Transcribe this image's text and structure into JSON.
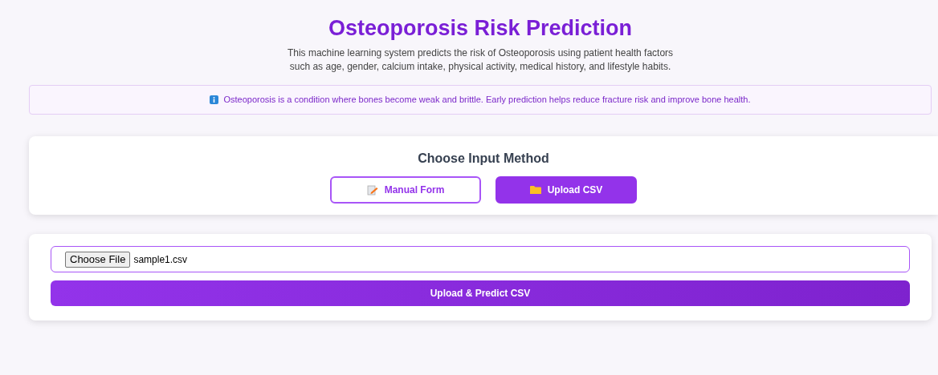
{
  "header": {
    "title": "Osteoporosis Risk Prediction",
    "description_lines": [
      "This machine learning system predicts the risk of Osteoporosis using patient health factors",
      "such as age, gender, calcium intake, physical activity, medical history, and lifestyle habits."
    ]
  },
  "info_banner": {
    "text": "Osteoporosis is a condition where bones become weak and brittle. Early prediction helps reduce fracture risk and improve bone health."
  },
  "input_method": {
    "heading": "Choose Input Method",
    "options": [
      {
        "label": "Manual Form",
        "kind": "form",
        "selected": false
      },
      {
        "label": "Upload CSV",
        "kind": "folder",
        "selected": true
      }
    ]
  },
  "upload": {
    "file_button": "Choose File",
    "file_name": "sample1.csv",
    "submit": "Upload & Predict CSV"
  }
}
